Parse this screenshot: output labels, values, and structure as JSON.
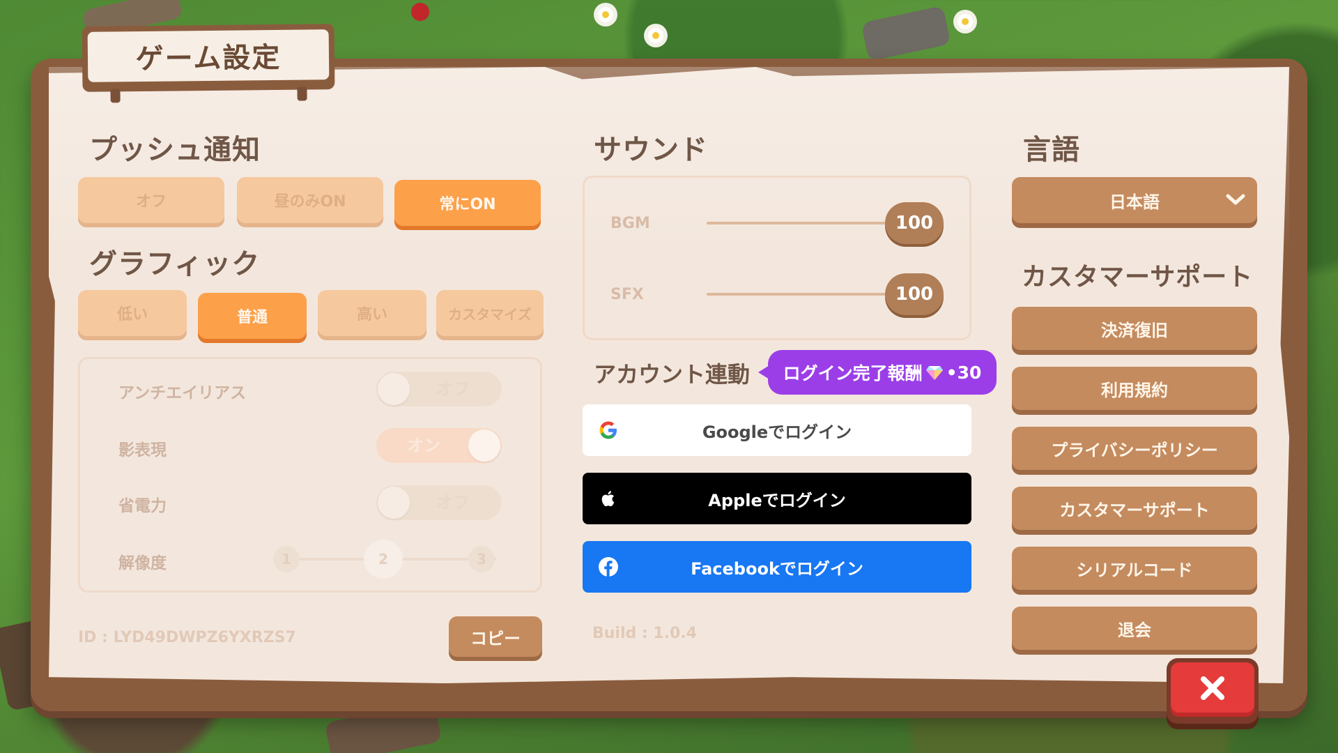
{
  "title": "ゲーム設定",
  "push": {
    "heading": "プッシュ通知",
    "options": [
      "オフ",
      "昼のみON",
      "常にON"
    ],
    "selected": "常にON"
  },
  "graphics": {
    "heading": "グラフィック",
    "options": [
      "低い",
      "普通",
      "高い",
      "カスタマイズ"
    ],
    "selected": "普通",
    "settings": {
      "antialias": {
        "label": "アンチエイリアス",
        "state": "オフ"
      },
      "shadow": {
        "label": "影表現",
        "state": "オン"
      },
      "power": {
        "label": "省電力",
        "state": "オフ"
      },
      "resolution": {
        "label": "解像度",
        "levels": [
          "1",
          "2",
          "3"
        ],
        "selected": "2"
      }
    }
  },
  "sound": {
    "heading": "サウンド",
    "bgm": {
      "label": "BGM",
      "value": "100",
      "level": 1.0
    },
    "sfx": {
      "label": "SFX",
      "value": "100",
      "level": 1.0
    }
  },
  "account": {
    "heading": "アカウント連動",
    "reward_text": "ログイン完了報酬",
    "reward_amount": "•30",
    "google": "Googleでログイン",
    "apple": "Appleでログイン",
    "facebook": "Facebookでログイン"
  },
  "language": {
    "heading": "言語",
    "selected": "日本語"
  },
  "support": {
    "heading": "カスタマーサポート",
    "buttons": [
      "決済復旧",
      "利用規約",
      "プライバシーポリシー",
      "カスタマーサポート",
      "シリアルコード",
      "退会"
    ]
  },
  "footer": {
    "id": "ID : LYD49DWPZ6YXRZS7",
    "copy": "コピー",
    "build": "Build : 1.0.4"
  },
  "colors": {
    "accent": "#fda04a",
    "brown": "#c48b5f",
    "purple": "#9b3ee8",
    "facebook": "#1877f2",
    "close": "#e53b3b"
  },
  "icons": {
    "google": "google-icon",
    "apple": "apple-icon",
    "facebook": "facebook-icon",
    "gem": "gem-icon",
    "chevron": "chevron-down-icon",
    "close": "close-icon"
  }
}
